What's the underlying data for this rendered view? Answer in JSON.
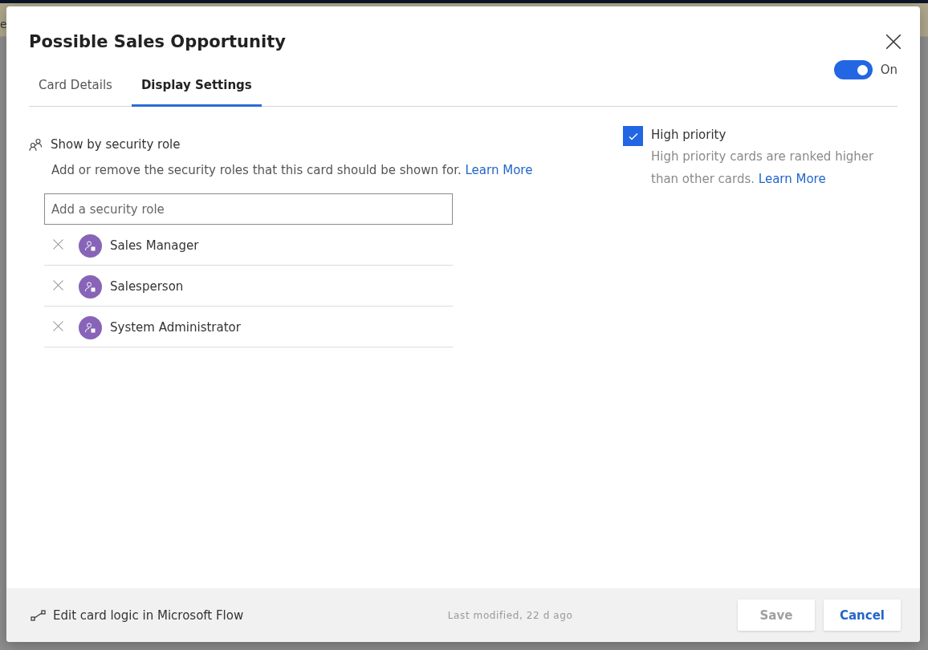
{
  "background": {
    "text": "e"
  },
  "dialog": {
    "title": "Possible Sales Opportunity",
    "tabs": [
      {
        "label": "Card Details",
        "selected": false
      },
      {
        "label": "Display Settings",
        "selected": true
      }
    ],
    "toggle": {
      "on": true,
      "label": "On"
    },
    "roles_section": {
      "heading": "Show by security role",
      "description": "Add or remove the security roles that this card should be shown for.",
      "link": "Learn More",
      "field": {
        "placeholder": "Add a security role"
      },
      "roles": [
        {
          "name": "Sales Manager"
        },
        {
          "name": "Salesperson"
        },
        {
          "name": "System Administrator"
        }
      ]
    },
    "priority": {
      "checked": true,
      "label": "High priority",
      "description": "High priority cards are ranked higher than other cards.",
      "link": "Learn More"
    },
    "footer": {
      "flow_link": "Edit card logic in Microsoft Flow",
      "modified": "Last modified, 22 d ago",
      "buttons": [
        {
          "label": "Save",
          "disabled": true
        },
        {
          "label": "Cancel",
          "disabled": false
        }
      ]
    }
  }
}
